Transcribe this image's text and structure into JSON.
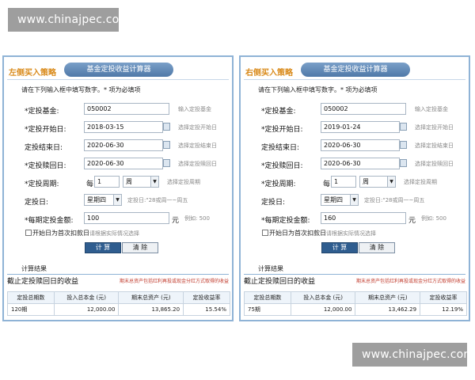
{
  "watermark": {
    "top": "www.chinajpec.com",
    "bottom": "www.chinajpec.com"
  },
  "panels": [
    {
      "strategy": "左侧买入策略",
      "tab": "基金定投收益计算器",
      "instruction": "请在下列输入框中填写数字。* 项为必填项",
      "fields": [
        {
          "label": "*定投基金:",
          "value": "050002",
          "hint": "输入定投基金"
        },
        {
          "label": "*定投开始日:",
          "value": "2018-03-15",
          "hint": "选择定投开始日"
        },
        {
          "label": "定投结束日:",
          "value": "2020-06-30",
          "hint": "选择定投结束日"
        },
        {
          "label": "*定投赎回日:",
          "value": "2020-06-30",
          "hint": "选择定投赎回日"
        }
      ],
      "period": {
        "label": "*定投周期:",
        "prefix": "每",
        "value": "1",
        "unit": "周",
        "hint": "选择定投周期"
      },
      "day": {
        "label": "定投日:",
        "value": "星期四",
        "hint": "定投日:\"28或周一~周五"
      },
      "amount": {
        "label": "*每期定投金额:",
        "value": "100",
        "unit": "元",
        "hint": "例如: 500"
      },
      "checkbox": {
        "label": "开始日为首次扣款日",
        "hint": "请根据实际情况选择"
      },
      "buttons": {
        "calc": "计 算",
        "clear": "清 除"
      },
      "result_title": "计算结果",
      "result_heading": "截止定投赎回日的收益",
      "result_note": "期末总资产包括红利再投或现金分红方式取得的收益",
      "table": {
        "headers": [
          "定投总期数",
          "投入总本金 (元)",
          "期末总资产 (元)",
          "定投收益率"
        ],
        "row": [
          "120期",
          "12,000.00",
          "13,865.20",
          "15.54%"
        ]
      }
    },
    {
      "strategy": "右侧买入策略",
      "tab": "基金定投收益计算器",
      "instruction": "请在下列输入框中填写数字。* 项为必填项",
      "fields": [
        {
          "label": "*定投基金:",
          "value": "050002",
          "hint": "输入定投基金"
        },
        {
          "label": "*定投开始日:",
          "value": "2019-01-24",
          "hint": "选择定投开始日"
        },
        {
          "label": "定投结束日:",
          "value": "2020-06-30",
          "hint": "选择定投结束日"
        },
        {
          "label": "*定投赎回日:",
          "value": "2020-06-30",
          "hint": "选择定投赎回日"
        }
      ],
      "period": {
        "label": "*定投周期:",
        "prefix": "每",
        "value": "1",
        "unit": "周",
        "hint": "选择定投周期"
      },
      "day": {
        "label": "定投日:",
        "value": "星期四",
        "hint": "定投日:\"28或周一~周五"
      },
      "amount": {
        "label": "*每期定投金额:",
        "value": "160",
        "unit": "元",
        "hint": "例如: 500"
      },
      "checkbox": {
        "label": "开始日为首次扣款日",
        "hint": "请根据实际情况选择"
      },
      "buttons": {
        "calc": "计 算",
        "clear": "清 除"
      },
      "result_title": "计算结果",
      "result_heading": "截止定投赎回日的收益",
      "result_note": "期末总资产包括红利再投或现金分红方式取得的收益",
      "table": {
        "headers": [
          "定投总期数",
          "投入总本金 (元)",
          "期末总资产 (元)",
          "定投收益率"
        ],
        "row": [
          "75期",
          "12,000.00",
          "13,462.29",
          "12.19%"
        ]
      }
    }
  ]
}
